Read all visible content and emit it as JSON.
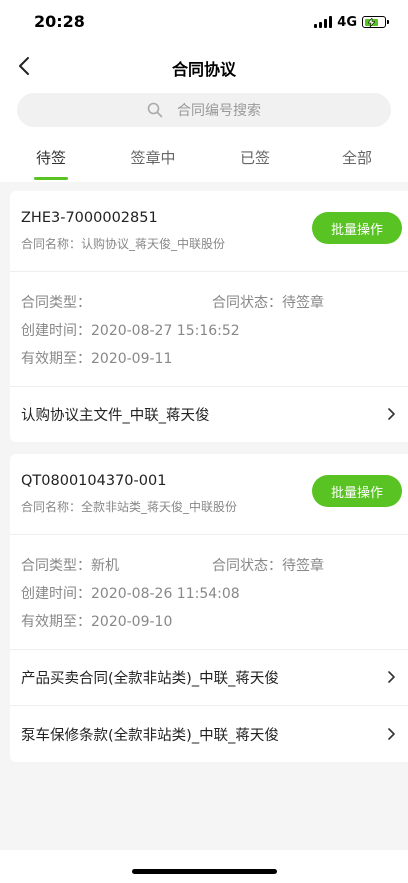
{
  "status_bar": {
    "time": "20:28",
    "network": "4G",
    "icons": [
      "signal-icon",
      "battery-charging-icon"
    ],
    "battery_color": "#58c322"
  },
  "nav": {
    "title": "合同协议",
    "back_icon": "chevron-left-icon"
  },
  "search": {
    "placeholder": "合同编号搜索",
    "icon": "search-icon"
  },
  "tabs": [
    {
      "label": "待签",
      "active": true
    },
    {
      "label": "签章中",
      "active": false
    },
    {
      "label": "已签",
      "active": false
    },
    {
      "label": "全部",
      "active": false
    }
  ],
  "accent_color": "#58c322",
  "contracts": [
    {
      "number": "ZHE3-7000002851",
      "name": "合同名称：认购协议_蒋天俊_中联股份",
      "batch_label": "批量操作",
      "type_label": "合同类型：",
      "type_value": "",
      "status_label": "合同状态：",
      "status_value": "待签章",
      "created_label": "创建时间：",
      "created_value": "2020-08-27 15:16:52",
      "valid_label": "有效期至：",
      "valid_value": "2020-09-11",
      "documents": [
        "认购协议主文件_中联_蒋天俊"
      ]
    },
    {
      "number": "QT0800104370-001",
      "name": "合同名称：全款非站类_蒋天俊_中联股份",
      "batch_label": "批量操作",
      "type_label": "合同类型：",
      "type_value": "新机",
      "status_label": "合同状态：",
      "status_value": "待签章",
      "created_label": "创建时间：",
      "created_value": "2020-08-26 11:54:08",
      "valid_label": "有效期至：",
      "valid_value": "2020-09-10",
      "documents": [
        "产品买卖合同(全款非站类)_中联_蒋天俊",
        "泵车保修条款(全款非站类)_中联_蒋天俊"
      ]
    }
  ]
}
